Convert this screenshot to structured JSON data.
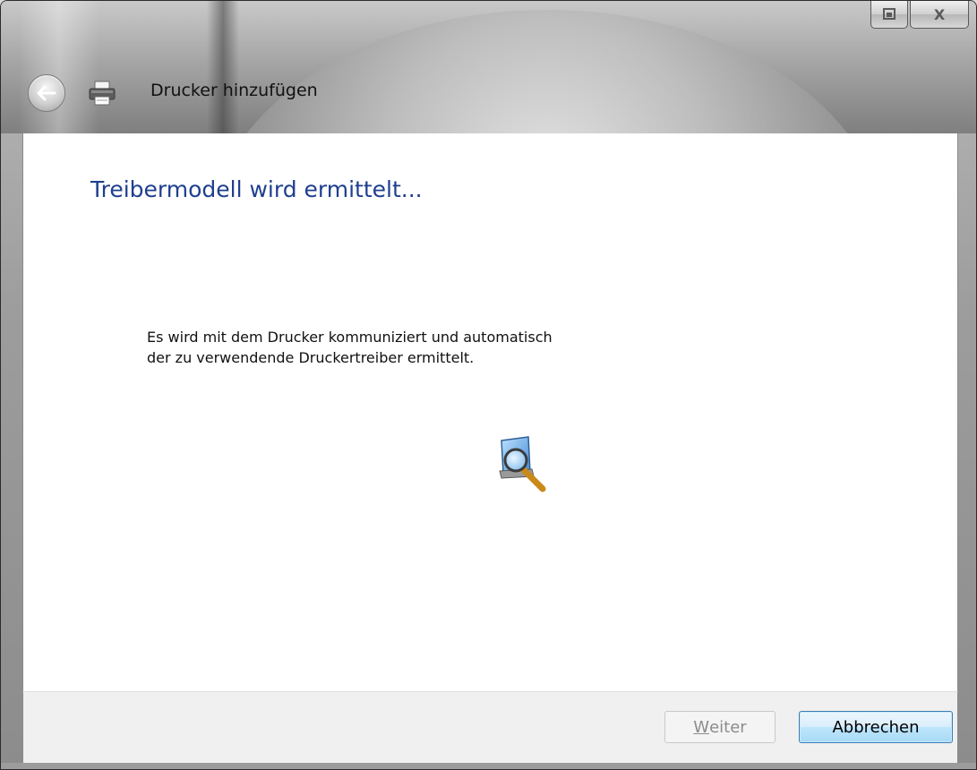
{
  "window": {
    "title": "Drucker hinzufügen"
  },
  "caption_buttons": {
    "restore_icon": "restore-icon",
    "close_label": "X"
  },
  "page": {
    "heading": "Treibermodell wird ermittelt...",
    "description_line1": "Es wird mit dem Drucker kommuniziert und automatisch",
    "description_line2": "der zu verwendende Druckertreiber ermittelt."
  },
  "buttons": {
    "next_accel": "W",
    "next_rest": "eiter",
    "next_enabled": false,
    "cancel": "Abbrechen"
  },
  "colors": {
    "heading": "#1f3f8e",
    "cancel_border": "#3c7fb1"
  }
}
